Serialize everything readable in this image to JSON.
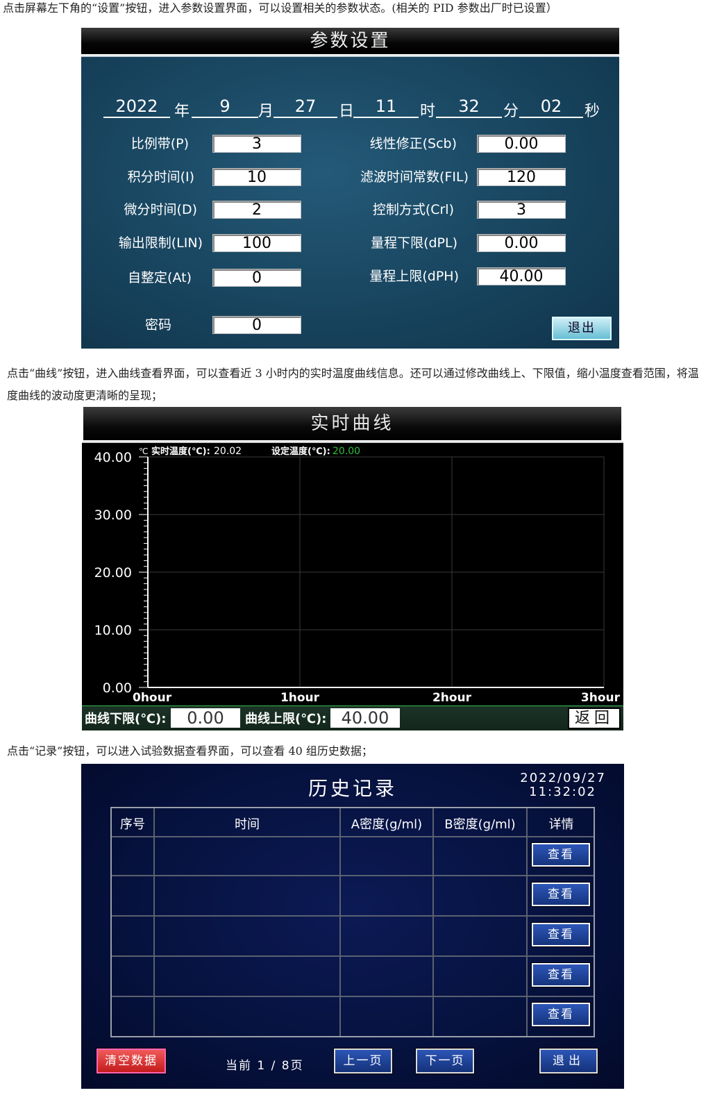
{
  "intro": {
    "para1": "点击屏幕左下角的“设置”按钮，进入参数设置界面，可以设置相关的参数状态。(相关的 PID 参数出厂时已设置）",
    "para2": "点击“曲线”按钮，进入曲线查看界面，可以查看近 3 小时内的实时温度曲线信息。还可以通过修改曲线上、下限值，缩小温度查看范围，将温度曲线的波动度更清晰的呈现；",
    "para3": "点击“记录”按钮，可以进入试验数据查看界面，可以查看 40 组历史数据；"
  },
  "settings": {
    "title": "参数设置",
    "datetime": {
      "year": "2022",
      "year_unit": "年",
      "month": "9",
      "month_unit": "月",
      "day": "27",
      "day_unit": "日",
      "hour": "11",
      "hour_unit": "时",
      "minute": "32",
      "minute_unit": "分",
      "second": "02",
      "second_unit": "秒"
    },
    "left": [
      {
        "label": "比例带(P)",
        "value": "3"
      },
      {
        "label": "积分时间(I)",
        "value": "10"
      },
      {
        "label": "微分时间(D)",
        "value": "2"
      },
      {
        "label": "输出限制(LIN)",
        "value": "100"
      },
      {
        "label": "自整定(At)",
        "value": "0"
      }
    ],
    "right": [
      {
        "label": "线性修正(Scb)",
        "value": "0.00"
      },
      {
        "label": "滤波时间常数(FIL)",
        "value": "120"
      },
      {
        "label": "控制方式(Crl)",
        "value": "3"
      },
      {
        "label": "量程下限(dPL)",
        "value": "0.00"
      },
      {
        "label": "量程上限(dPH)",
        "value": "40.00"
      }
    ],
    "password": {
      "label": "密码",
      "value": "0"
    },
    "exit_label": "退出"
  },
  "curve": {
    "title": "实时曲线",
    "unit": "℃",
    "realtime_label": "实时温度(℃):",
    "realtime_value": "20.02",
    "setpoint_label": "设定温度(℃):",
    "setpoint_value": "20.00",
    "lower_label": "曲线下限(℃):",
    "lower_value": "0.00",
    "upper_label": "曲线上限(℃):",
    "upper_value": "40.00",
    "back_label": "返回",
    "colors": {
      "setpoint": "#2fbf3a",
      "grid": "#3a3a3a",
      "axis": "#ffffff"
    }
  },
  "chart_data": {
    "type": "line",
    "title": "实时曲线",
    "x_ticks": [
      "0hour",
      "1hour",
      "2hour",
      "3hour"
    ],
    "y_ticks": [
      "0.00",
      "10.00",
      "20.00",
      "30.00",
      "40.00"
    ],
    "ylim": [
      0,
      40
    ],
    "series": [],
    "grid": true
  },
  "history": {
    "title": "历史记录",
    "date": "2022/09/27",
    "time": "11:32:02",
    "columns": [
      "序号",
      "时间",
      "A密度(g/ml)",
      "B密度(g/ml)",
      "详情"
    ],
    "rows": [
      {
        "view": "查看"
      },
      {
        "view": "查看"
      },
      {
        "view": "查看"
      },
      {
        "view": "查看"
      },
      {
        "view": "查看"
      }
    ],
    "clear_label": "清空数据",
    "page_label": "当前 1 / 8页",
    "prev_label": "上一页",
    "next_label": "下一页",
    "exit_label": "退出"
  }
}
